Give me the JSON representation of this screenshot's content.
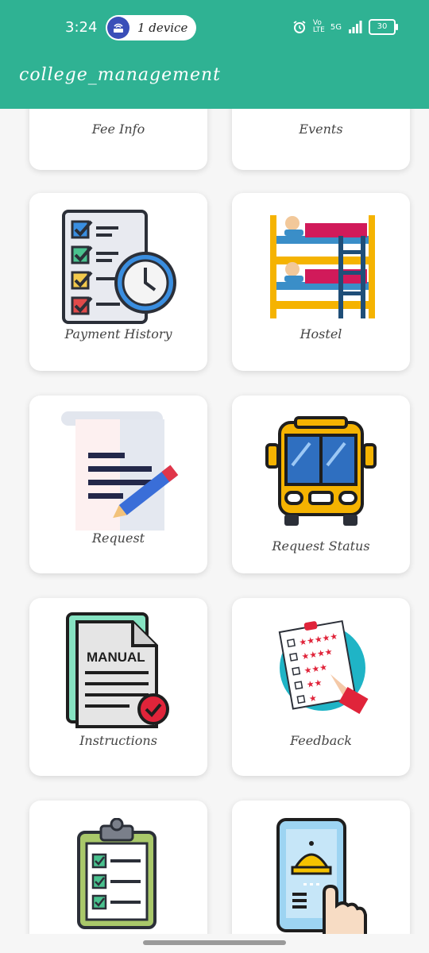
{
  "status": {
    "time": "3:24",
    "device_pill": "1 device",
    "network": "5G",
    "volte": "Vo LTE",
    "battery": "30"
  },
  "app": {
    "title": "college_management"
  },
  "cards": [
    {
      "label": "Fee Info",
      "icon": "fee-info-icon"
    },
    {
      "label": "Events",
      "icon": "events-icon"
    },
    {
      "label": "Payment History",
      "icon": "checklist-clock-icon"
    },
    {
      "label": "Hostel",
      "icon": "bunk-bed-icon"
    },
    {
      "label": "Request",
      "icon": "document-pencil-icon"
    },
    {
      "label": "Request Status",
      "icon": "bus-icon"
    },
    {
      "label": "Instructions",
      "icon": "manual-icon"
    },
    {
      "label": "Feedback",
      "icon": "feedback-icon"
    },
    {
      "label": "",
      "icon": "clipboard-checklist-icon"
    },
    {
      "label": "",
      "icon": "phone-tap-icon"
    }
  ],
  "manual_text": "MANUAL"
}
